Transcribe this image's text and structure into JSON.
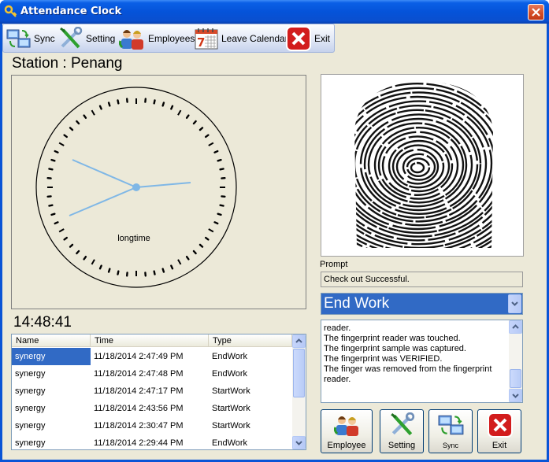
{
  "window": {
    "title": "Attendance Clock"
  },
  "toolbar": {
    "sync_label": "Sync",
    "setting_label": "Setting",
    "employees_label": "Employees",
    "leave_label": "Leave Calendar",
    "exit_label": "Exit"
  },
  "station": {
    "label": "Station : Penang"
  },
  "clock": {
    "caption": "longtime",
    "digital_time": "14:48:41"
  },
  "attendance": {
    "columns": [
      "Name",
      "Time",
      "Type"
    ],
    "rows": [
      {
        "name": "synergy",
        "time": "11/18/2014 2:47:49 PM",
        "type": "EndWork",
        "selected": true
      },
      {
        "name": "synergy",
        "time": "11/18/2014 2:47:48 PM",
        "type": "EndWork"
      },
      {
        "name": "synergy",
        "time": "11/18/2014 2:47:17 PM",
        "type": "StartWork"
      },
      {
        "name": "synergy",
        "time": "11/18/2014 2:43:56 PM",
        "type": "StartWork"
      },
      {
        "name": "synergy",
        "time": "11/18/2014 2:30:47 PM",
        "type": "StartWork"
      },
      {
        "name": "synergy",
        "time": "11/18/2014 2:29:44 PM",
        "type": "EndWork"
      }
    ]
  },
  "prompt": {
    "label": "Prompt",
    "status": "Check out Successful."
  },
  "work_type": {
    "selected": "End Work"
  },
  "log": {
    "lines": [
      "reader.",
      "The fingerprint reader was touched.",
      "The fingerprint sample was captured.",
      "The fingerprint was VERIFIED.",
      "The finger was removed from the fingerprint",
      "reader."
    ]
  },
  "actions": {
    "employee_label": "Employee",
    "setting_label": "Setting",
    "sync_label": "Sync",
    "exit_label": "Exit"
  },
  "colors": {
    "title_bar": "#0a54d6",
    "selection": "#316ac5",
    "face": "#ece9d8",
    "clock_hand": "#7fb7e6"
  }
}
